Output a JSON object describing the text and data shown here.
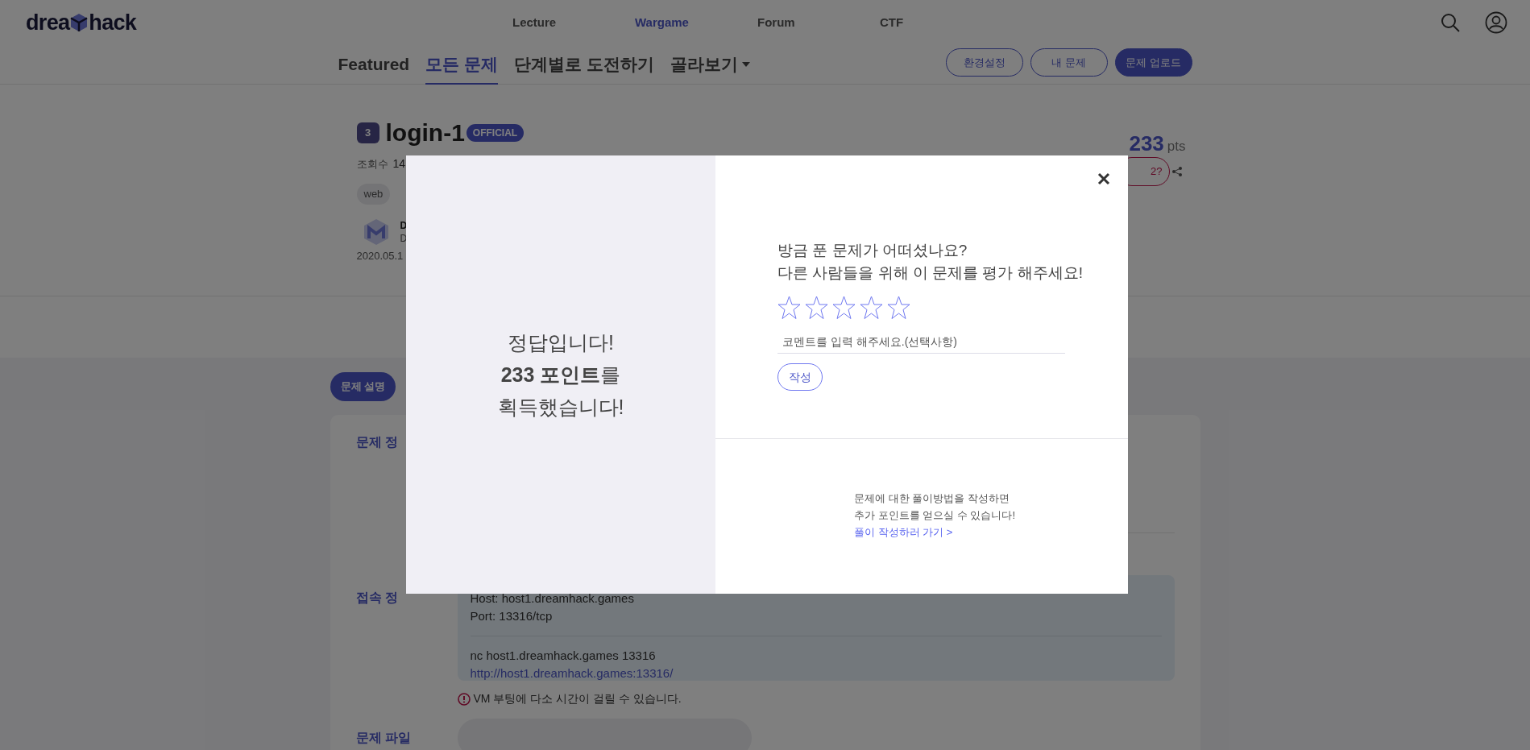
{
  "logo": {
    "left": "drea",
    "right": "hack"
  },
  "nav": [
    {
      "label": "Lecture",
      "selected": false
    },
    {
      "label": "Wargame",
      "selected": true
    },
    {
      "label": "Forum",
      "selected": false
    },
    {
      "label": "CTF",
      "selected": false
    }
  ],
  "tabs": [
    {
      "label": "Featured",
      "selected": false,
      "kind": "link"
    },
    {
      "label": "모든 문제",
      "selected": true,
      "kind": "link"
    },
    {
      "label": "단계별로 도전하기",
      "selected": false,
      "kind": "link"
    },
    {
      "label": "골라보기",
      "selected": false,
      "kind": "menu"
    }
  ],
  "header_buttons": [
    {
      "label": "환경설정",
      "kind": "outline"
    },
    {
      "label": "내 문제",
      "kind": "outline"
    },
    {
      "label": "문제 업로드",
      "kind": "filled"
    }
  ],
  "challenge": {
    "level": "3",
    "title": "login-1",
    "badge": "OFFICIAL",
    "points": "233",
    "points_unit": "pts",
    "stat_label": "조회수",
    "stat_value": "14",
    "tags": [
      "web"
    ],
    "author_name": "D",
    "author_sub": "D",
    "date": "2020.05.1",
    "question_button": "2?"
  },
  "detail": {
    "tabs": [
      {
        "label": "문제 설명",
        "selected": true
      }
    ],
    "info_label": "문제 정",
    "connection_label": "접속 정",
    "connection_lines": [
      "Host: host1.dreamhack.games",
      "Port: 13316/tcp"
    ],
    "command": "nc host1.dreamhack.games 13316",
    "url": "http://host1.dreamhack.games:13316/",
    "notice": "VM 부팅에 다소 시간이 걸릴 수 있습니다.",
    "files_label": "문제 파일"
  },
  "modal": {
    "left_lines": [
      "정답입니다!",
      "**233 포인트**를",
      "획득했습니다!"
    ],
    "question_lines": [
      "방금 푼 문제가 어떠셨나요?",
      "다른 사람들을 위해 이 문제를 평가 해주세요!"
    ],
    "stars": 0,
    "comment_placeholder": "코멘트를 입력 해주세요.(선택사항)",
    "submit": "작성",
    "writeup_lines": [
      "문제에 대한 풀이방법을 작성하면",
      "추가 포인트를 얻으실 수 있습니다!"
    ],
    "writeup_link": "풀이 작성하러 가기 >"
  }
}
